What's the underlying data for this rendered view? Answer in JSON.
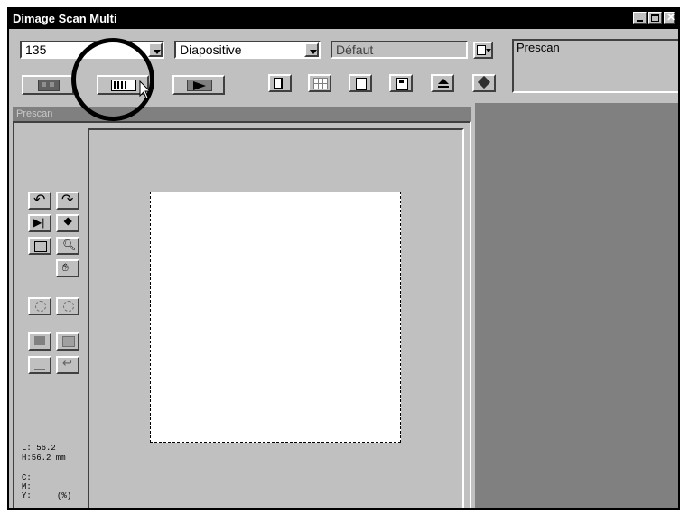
{
  "window": {
    "title": "Dimage Scan Multi"
  },
  "toolbar": {
    "film_format": "135",
    "film_type": "Diapositive",
    "setting": "Défaut",
    "status_label": "Prescan"
  },
  "panel": {
    "title": "Prescan"
  },
  "info": {
    "length": "L: 56.2",
    "height": "H:56.2  mm",
    "c": "C:",
    "m": "M:",
    "y": "Y:",
    "unit": "(%)"
  },
  "colors": {
    "title_bar": "#000000",
    "face": "#c0c0c0",
    "dark_area": "#808080",
    "highlight_ring": "#000000"
  }
}
